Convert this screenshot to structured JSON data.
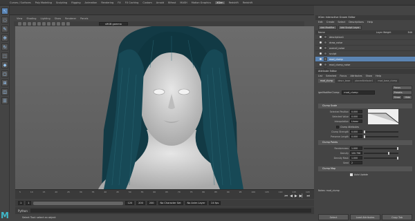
{
  "shelf_tabs": [
    "Curves / Surfaces",
    "Poly Modeling",
    "Sculpting",
    "Rigging",
    "Animation",
    "Rendering",
    "FX",
    "FX Caching",
    "Custom",
    "Arnold",
    "Bifrost",
    "MASH",
    "Motion Graphics",
    "XGen",
    "Redshift",
    "Redshift"
  ],
  "active_shelf": "XGen",
  "viewport_menu": [
    "View",
    "Shading",
    "Lighting",
    "Show",
    "Renderer",
    "Panels"
  ],
  "gamma": "sRGB gamma",
  "timeline_ticks": [
    "5",
    "10",
    "15",
    "20",
    "25",
    "30",
    "35",
    "40",
    "45",
    "50",
    "55",
    "60",
    "65",
    "70",
    "75",
    "80",
    "85",
    "90",
    "95",
    "100",
    "105",
    "110",
    "115",
    "120"
  ],
  "range": {
    "start": "1",
    "start2": "1",
    "end": "120",
    "end2": "200",
    "end3": "200"
  },
  "range_menus": {
    "char_set": "No Character Set",
    "anim_layer": "No Anim Layer",
    "fps": "24 fps"
  },
  "cmdline_label": "Python",
  "help_line": "Select Tool: select an object",
  "logo": "M",
  "xgen": {
    "title": "XGen Interactive Groom Editor",
    "menu": [
      "Edit",
      "Create",
      "Select",
      "Descriptions",
      "Help"
    ],
    "add_modifier": "Add Modifier",
    "add_sculpt": "Add Sculpt Layer",
    "col_name": "Name",
    "col_weight": "Layer Weight",
    "col_edit": "Edit",
    "layers": [
      {
        "name": "description1",
        "sel": false
      },
      {
        "name": "draw_noise",
        "sel": false
      },
      {
        "name": "overall_noise",
        "sel": false
      },
      {
        "name": "sculpt",
        "sel": false
      },
      {
        "name": "mod_clump",
        "sel": true
      },
      {
        "name": "mod_clump_noise",
        "sel": false
      },
      {
        "name": "base_strands",
        "sel": false
      }
    ]
  },
  "attr": {
    "title": "Attribute Editor",
    "menu": [
      "List",
      "Selected",
      "Focus",
      "Attributes",
      "Show",
      "Help"
    ],
    "tabs": [
      "mod_clump",
      "descr_base",
      "placerAttribute1",
      "mod_base_clump"
    ],
    "node_label": "igmModifierClump:",
    "node_value": "mod_clump",
    "focus": "Focus",
    "presets": "Presets",
    "show": "Show",
    "hide": "Hide",
    "clump_scale": "Clump Scale",
    "sel_pos_label": "Selected Position",
    "sel_pos": "0.000",
    "sel_val_label": "Selected Value",
    "sel_val": "0.000",
    "interp_label": "Interpolation",
    "interp": "Linear",
    "clump_attr": "Clump Attributes",
    "clump_strength_label": "Clump Strength",
    "clump_strength": "0.000",
    "preserve_length_label": "Preserve Length",
    "preserve_length": "0.000",
    "clump_points": "Clump Points",
    "randomness_label": "Randomness",
    "randomness": "1.000",
    "density_label": "Density",
    "density": "100.796",
    "density_mask_label": "Density Mask",
    "density_mask": "1.000",
    "seed_label": "Seed",
    "seed": "2",
    "clump_map": "Clump Map",
    "auto_update": "Auto Update",
    "notes": "Notes: mod_clump"
  },
  "bottom_buttons": [
    "Select",
    "Load Attributes",
    "Copy Tab"
  ]
}
